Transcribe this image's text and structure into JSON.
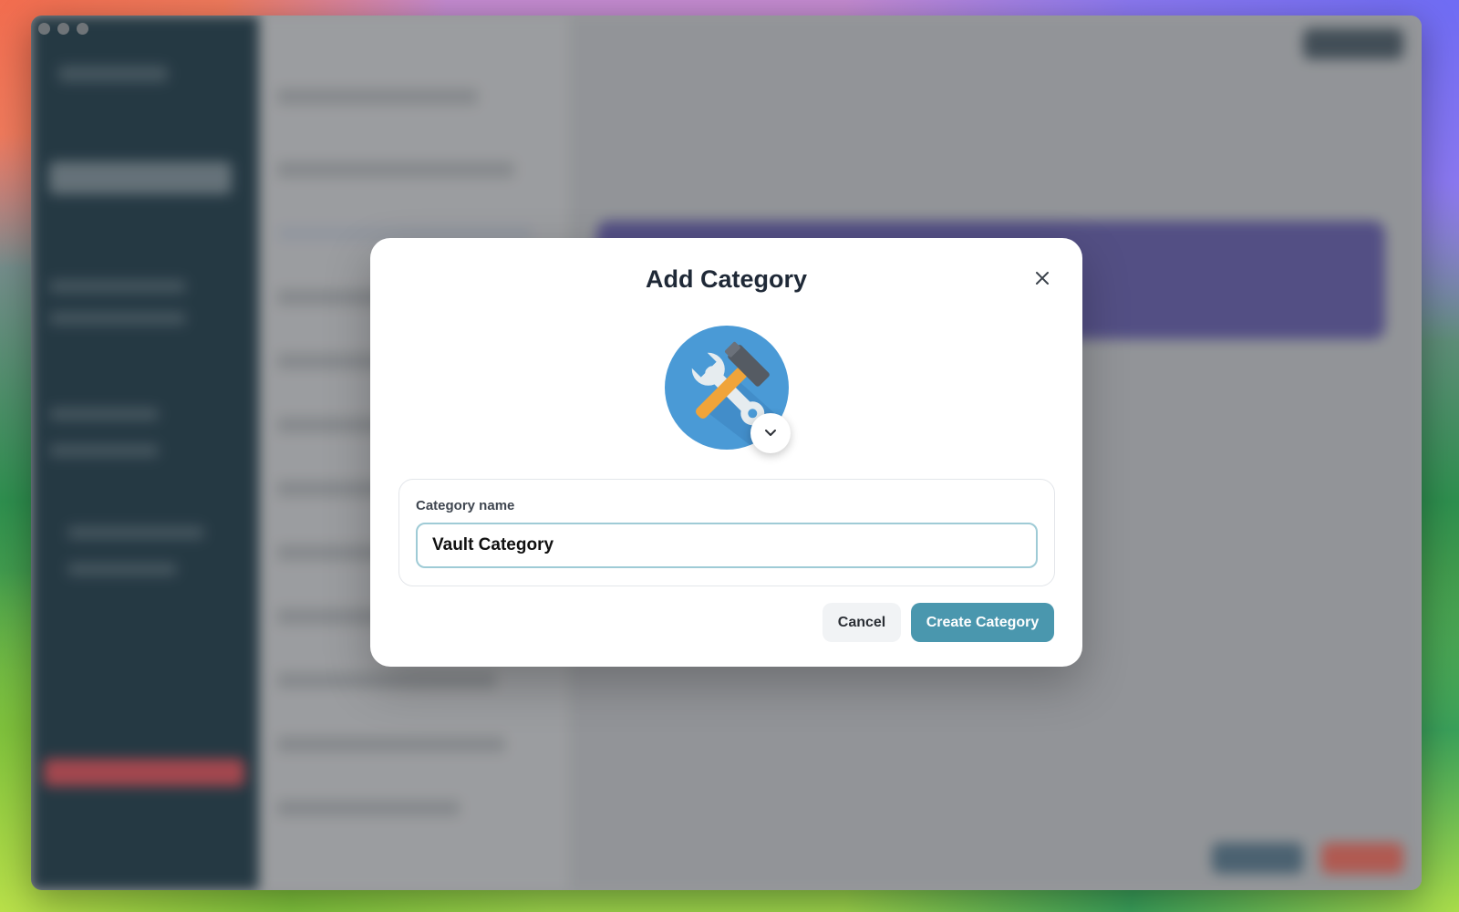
{
  "modal": {
    "title": "Add Category",
    "close_icon": "close-icon",
    "category_icon": "hammer-and-wrench-icon",
    "icon_picker_icon": "chevron-down-icon",
    "field": {
      "label": "Category name",
      "value": "Vault Category",
      "placeholder": ""
    },
    "buttons": {
      "cancel_label": "Cancel",
      "create_label": "Create Category"
    }
  },
  "colors": {
    "accent": "#4a97ae",
    "icon_background": "#4a9ad6"
  }
}
